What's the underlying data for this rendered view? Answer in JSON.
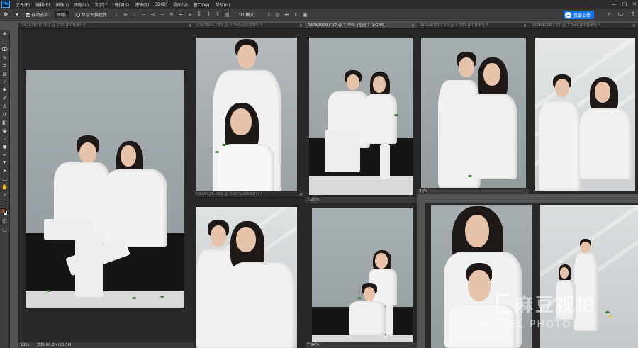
{
  "app": {
    "logo_text": "Ps"
  },
  "menu": [
    "文件(F)",
    "编辑(E)",
    "图像(I)",
    "图层(L)",
    "文字(Y)",
    "选择(S)",
    "滤镜(T)",
    "3D(D)",
    "视图(V)",
    "窗口(W)",
    "帮助(H)"
  ],
  "window_controls": {
    "minimize": "—",
    "maximize": "□",
    "close": "✕"
  },
  "options": {
    "auto_select_label": "自动选择：",
    "auto_select_value": "图层",
    "show_transform_label": "显示变换控件",
    "mode_3d": "3D 模式：",
    "cloud_button": "我要上传",
    "more": "···"
  },
  "documents": [
    {
      "tab": "342A3818.CR2 @ 11%(RGB/8*) *",
      "status_zoom": "11%",
      "status_doc": "文档:80.3M/80.3M"
    },
    {
      "tab": "42A3864.CR2 @ 7.34%(RGB/8*) *"
    },
    {
      "tab": "342A3929.CR2 @ 7.25% (图层 1, RGB/8...",
      "status_zoom": "7.25%"
    },
    {
      "tab": "342A4072.CR2 @ 7.39%(RGB/8*) *",
      "status_zoom": "39%"
    },
    {
      "tab": "342A4118.CR2 @ 7.34%(RGB/8*) *"
    },
    {
      "tab": "42A4126.CR2 @ 7.25%(RGB/8*) *"
    },
    {
      "tab": "",
      "status_zoom": "7.94%"
    },
    {
      "tab": "",
      "status_zoom": ""
    },
    {
      "tab": "",
      "status_zoom": ""
    }
  ],
  "watermark": {
    "cn": "麻豆视拍",
    "en": "MODEL PHOTO"
  }
}
